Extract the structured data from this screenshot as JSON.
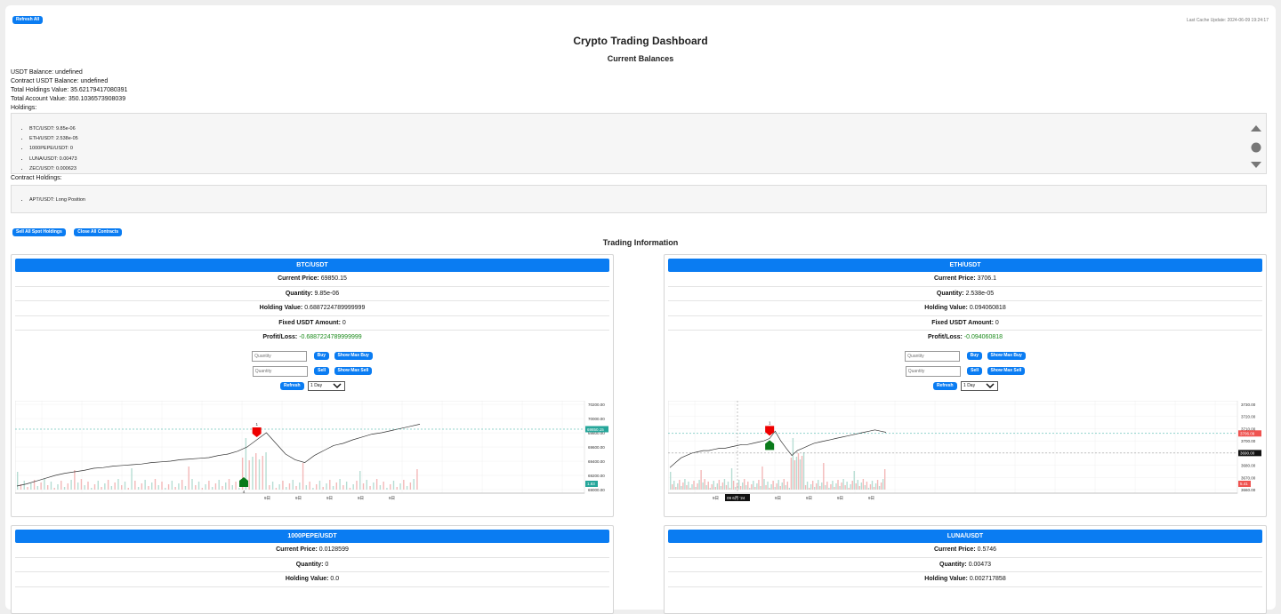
{
  "header": {
    "refresh_all": "Refresh All",
    "last_cache": "Last Cache Update: 2024-06-09 19:24:17",
    "title": "Crypto Trading Dashboard",
    "subtitle": "Current Balances"
  },
  "balances": {
    "usdt": "USDT Balance: undefined",
    "contract_usdt": "Contract USDT Balance: undefined",
    "total_holdings": "Total Holdings Value: 35.62179417080391",
    "total_account": "Total Account Value: 350.1036573908039",
    "holdings_label": "Holdings:"
  },
  "holdings": [
    "BTC/USDT: 9.85e-06",
    "ETH/USDT: 2.538e-05",
    "1000PEPE/USDT: 0",
    "LUNA/USDT: 0.00473",
    "ZEC/USDT: 0.000623"
  ],
  "contract_label": "Contract Holdings:",
  "contract_holdings": [
    "APT/USDT: Long Position"
  ],
  "actions": {
    "sell_all": "Sell All Spot Holdings",
    "close_all": "Close All Contracts"
  },
  "trading_title": "Trading Information",
  "labels": {
    "current_price": "Current Price:",
    "quantity": "Quantity:",
    "holding_value": "Holding Value:",
    "fixed_usdt": "Fixed USDT Amount:",
    "profit_loss": "Profit/Loss:",
    "qty_placeholder": "Quantity",
    "buy": "Buy",
    "sell": "Sell",
    "max_buy": "Show Max Buy",
    "max_sell": "Show Max Sell",
    "refresh": "Refresh",
    "period": "1 Day"
  },
  "cards": [
    {
      "symbol": "BTC/USDT",
      "price": "69850.15",
      "quantity": "9.85e-06",
      "holding_value": "0.6887224789999999",
      "fixed_usdt": "0",
      "profit_loss": "-0.6887224789999999",
      "chart": {
        "y_ticks": [
          "70200.00",
          "70000.00",
          "69800.00",
          "69600.00",
          "69400.00",
          "69200.00",
          "69000.00"
        ],
        "x_ticks": [
          "9日",
          "9日",
          "9日",
          "9日",
          "9日"
        ],
        "price_tag": "69850.15",
        "volume_tag": "1.83",
        "sell_marker": "1",
        "buy_marker": "4",
        "y_min": 69000,
        "y_max": 70200,
        "series": [
          69050,
          69080,
          69120,
          69160,
          69200,
          69230,
          69250,
          69270,
          69300,
          69310,
          69330,
          69340,
          69350,
          69360,
          69380,
          69390,
          69400,
          69420,
          69430,
          69440,
          69450,
          69480,
          69500,
          69540,
          69600,
          69700,
          69800,
          69650,
          69500,
          69420,
          69380,
          69480,
          69550,
          69620,
          69650,
          69700,
          69740,
          69780,
          69800,
          69830,
          69860,
          69890,
          69920
        ],
        "price_line": 69850.15,
        "sell_index": 25,
        "buy_index": 0
      }
    },
    {
      "symbol": "ETH/USDT",
      "price": "3706.1",
      "quantity": "2.538e-05",
      "holding_value": "0.094060818",
      "fixed_usdt": "0",
      "profit_loss": "-0.094060818",
      "chart": {
        "y_ticks": [
          "3730.00",
          "3720.00",
          "3710.00",
          "3700.00",
          "3690.00",
          "3680.00",
          "3670.00",
          "3660.00"
        ],
        "x_ticks": [
          "9日",
          "9日",
          "9日",
          "9日",
          "9日",
          "9日"
        ],
        "date_tag": "09 6月 '24",
        "price_tag": "3706.09",
        "cross_tag": "3690.00",
        "volume_tag": "5.41",
        "sell_marker": "1",
        "y_min": 3660,
        "y_max": 3730,
        "series": [
          3678,
          3682,
          3686,
          3688,
          3690,
          3691,
          3692,
          3692,
          3693,
          3694,
          3694,
          3695,
          3696,
          3697,
          3697,
          3698,
          3699,
          3700,
          3702,
          3708,
          3700,
          3694,
          3688,
          3692,
          3694,
          3696,
          3698,
          3699,
          3700,
          3701,
          3702,
          3703,
          3704,
          3705,
          3706,
          3707,
          3708,
          3709,
          3708,
          3707
        ],
        "price_line": 3706.09,
        "cross_line": 3690,
        "sell_index": 18,
        "buy_index": 18
      }
    },
    {
      "symbol": "1000PEPE/USDT",
      "price": "0.0128599",
      "quantity": "0",
      "holding_value": "0.0"
    },
    {
      "symbol": "LUNA/USDT",
      "price": "0.5746",
      "quantity": "0.00473",
      "holding_value": "0.002717858"
    }
  ]
}
